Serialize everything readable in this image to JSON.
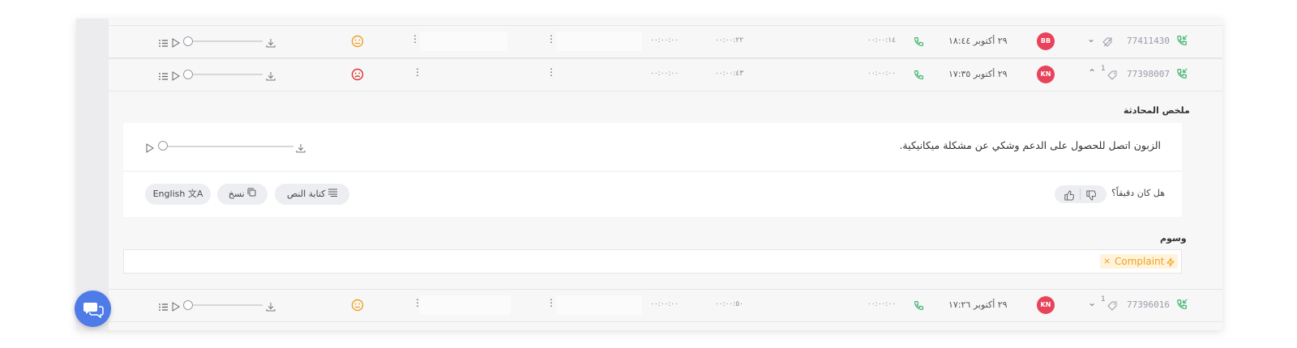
{
  "rows": [
    {
      "phone": "77411430",
      "chevron": "⌄",
      "count": "",
      "agent": "BB",
      "date": "٢٩ أكتوبر ١٨:٤٤",
      "dur1": "٠٠:٠٠:١٤",
      "dur2": "٠٠:٠٠:٢٢",
      "dur3": "٠٠:٠٠:٠٠",
      "sentiment": "neutral",
      "sentiment_color": "#f0a020"
    },
    {
      "phone": "77398007",
      "chevron": "⌃",
      "count": "1",
      "agent": "KN",
      "date": "٢٩ أكتوبر ١٧:٣٥",
      "dur1": "٠٠:٠٠:٠٠",
      "dur2": "٠٠:٠٠:٤٣",
      "dur3": "٠٠:٠٠:٠٠",
      "sentiment": "sad",
      "sentiment_color": "#e0322d"
    },
    {
      "phone": "77396016",
      "chevron": "⌄",
      "count": "1",
      "agent": "KN",
      "date": "٢٩ أكتوبر ١٧:٢٦",
      "dur1": "٠٠:٠٠:٠٠",
      "dur2": "٠٠:٠٠:٥٠",
      "dur3": "٠٠:٠٠:٠٠",
      "sentiment": "neutral",
      "sentiment_color": "#f0a020"
    }
  ],
  "summary": {
    "title": "ملخص المحادثة",
    "text": "الزبون اتصل للحصول على الدعم وشكي عن مشكلة ميكانيكية.",
    "accurate_question": "هل كان دقيقاً؟",
    "transcript_label": "كتابة النص",
    "copy_label": "نسخ",
    "translate_label": "English"
  },
  "tags": {
    "title": "وسوم",
    "items": [
      {
        "label": "Complaint",
        "remove": "×"
      }
    ]
  },
  "colors": {
    "accent": "#4e7be8",
    "call_green": "#3bb36b",
    "avatar_red": "#e8435a",
    "tag_orange": "#f0a020"
  }
}
